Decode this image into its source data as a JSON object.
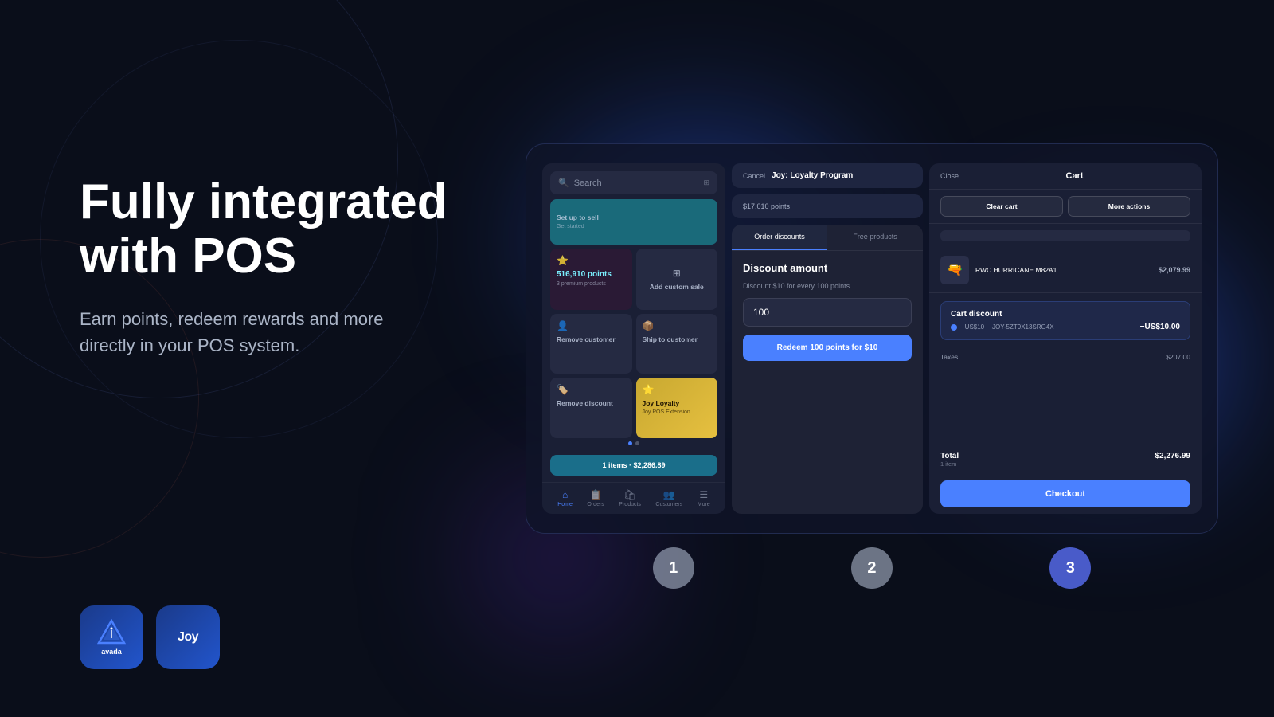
{
  "page": {
    "bg_color": "#0a0e1a"
  },
  "heading": {
    "line1": "Fully integrated",
    "line2": "with POS"
  },
  "subtext": "Earn points, redeem rewards and more\ndirectly in your POS system.",
  "logos": {
    "avada_label": "avada",
    "joy_label": "Joy"
  },
  "steps": {
    "step1": "1",
    "step2": "2",
    "step3": "3"
  },
  "panel1": {
    "search_placeholder": "Search",
    "setup_label": "Set up to sell",
    "setup_sub": "Get started",
    "points_label": "516,910 points",
    "points_sub": "3 premium products",
    "add_custom_label": "Add custom sale",
    "remove_customer_label": "Remove customer",
    "ship_label": "Ship to customer",
    "remove_discount_label": "Remove discount",
    "joy_tile_label": "Joy Loyalty",
    "joy_tile_sub": "Joy POS Extension",
    "bottom_bar": "1 items · $2,286.89",
    "nav_home": "Home",
    "nav_orders": "Orders",
    "nav_products": "Products",
    "nav_customers": "Customers",
    "nav_more": "More"
  },
  "panel2": {
    "cancel_label": "Cancel",
    "title": "Joy: Loyalty Program",
    "points_info": "$17,010 points",
    "tab1": "Order discounts",
    "tab2": "Free products",
    "amount_label": "Discount amount",
    "desc": "Discount $10 for every 100 points",
    "points_input": "100",
    "redeem_btn": "Redeem 100 points for $10"
  },
  "panel3": {
    "close_label": "Close",
    "cart_title": "Cart",
    "clear_cart_btn": "Clear cart",
    "more_actions_btn": "More actions",
    "product_name": "RWC HURRICANE M82A1",
    "product_price": "$2,079.99",
    "discount_title": "Cart discount",
    "discount_label": "−US$10 ·",
    "discount_code": "JOY-5ZT9X13SRG4X",
    "discount_amount": "−US$10.00",
    "taxes_label": "Taxes",
    "taxes_value": "$207.00",
    "total_label": "Total",
    "total_sub": "1 item",
    "total_value": "$2,276.99",
    "checkout_btn": "Checkout"
  }
}
